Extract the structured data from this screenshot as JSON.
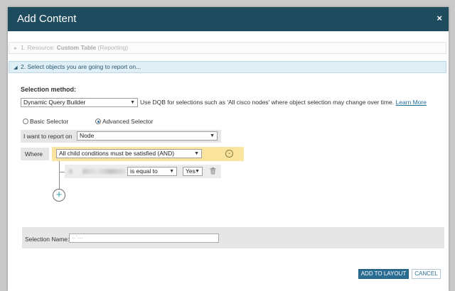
{
  "dialog": {
    "title": "Add Content",
    "close_glyph": "×"
  },
  "steps": [
    {
      "prefix": "1. Resource: ",
      "strong": "Custom Table",
      "suffix": " (Reporting)",
      "arrow": "▸",
      "state": "collapsed"
    },
    {
      "text": "2. Select objects you are going to report on...",
      "arrow": "◢",
      "state": "expanded"
    }
  ],
  "selection_method": {
    "label": "Selection method:",
    "value": "Dynamic Query Builder",
    "hint": "Use DQB for selections such as 'All cisco nodes' where object selection may change over time.",
    "learn_more": "Learn More"
  },
  "selector": {
    "basic_label": "Basic Selector",
    "advanced_label": "Advanced Selector",
    "selected": "advanced"
  },
  "report_on": {
    "label": "I want to report on",
    "value": "Node"
  },
  "where": {
    "label": "Where",
    "conjunction": "All child conditions must be satisfied (AND)",
    "collapse_glyph": "⌄"
  },
  "condition": {
    "operator": "is equal to",
    "value": "Yes"
  },
  "selection_name": {
    "label": "Selection Name:",
    "value": "··˙···"
  },
  "actions": {
    "primary": "ADD TO LAYOUT",
    "secondary": "CANCEL"
  },
  "colors": {
    "titlebar": "#1f4b5e",
    "active_step_bg": "#e0eef6",
    "and_highlight": "#fbe59e",
    "primary_button": "#2a6d93"
  }
}
